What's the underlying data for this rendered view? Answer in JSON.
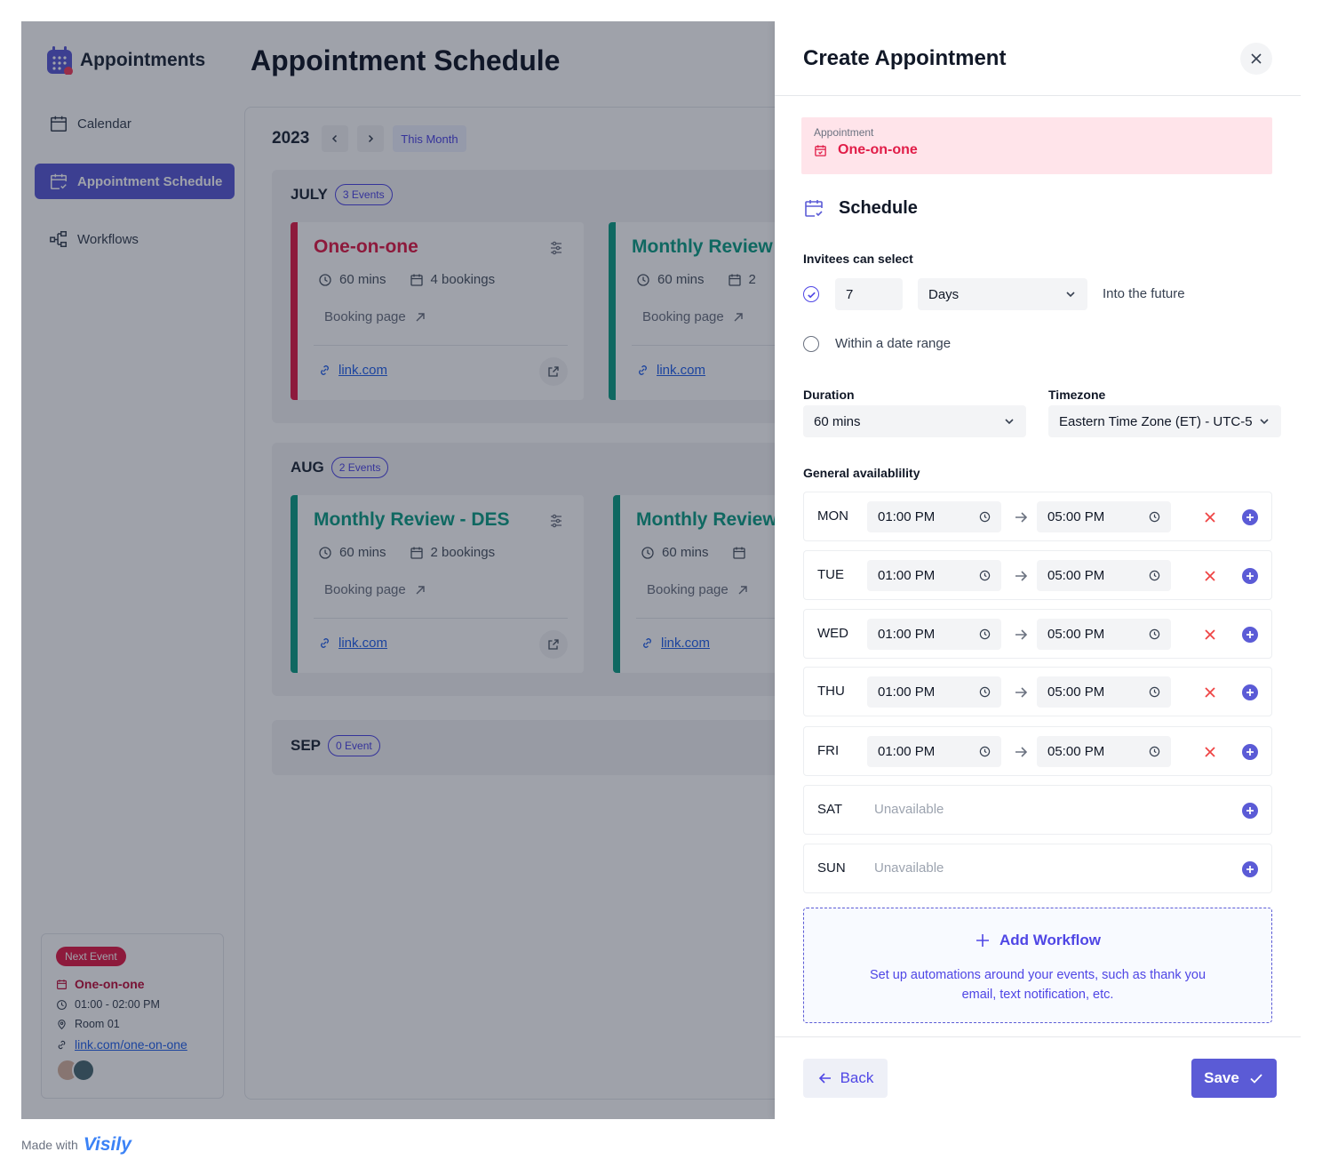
{
  "sidebar": {
    "brand": "Appointments",
    "items": [
      {
        "label": "Calendar",
        "icon": "calendar-icon"
      },
      {
        "label": "Appointment Schedule",
        "icon": "calendar-check-icon",
        "active": true
      },
      {
        "label": "Workflows",
        "icon": "workflow-icon"
      }
    ],
    "next_event": {
      "badge": "Next Event",
      "title": "One-on-one",
      "time": "01:00 - 02:00 PM",
      "location": "Room 01",
      "link": "link.com/one-on-one"
    }
  },
  "main": {
    "title": "Appointment Schedule",
    "year": "2023",
    "this_month": "This Month",
    "months": [
      {
        "name": "JULY",
        "events": "3 Events",
        "cards": [
          {
            "title": "One-on-one",
            "duration": "60 mins",
            "bookings": "4 bookings",
            "booking_page": "Booking page",
            "link": "link.com",
            "color": "#e11d48"
          },
          {
            "title": "Monthly Review",
            "duration": "60 mins",
            "bookings": "2",
            "booking_page": "Booking page",
            "link": "link.com",
            "color": "#0f9e86"
          }
        ]
      },
      {
        "name": "AUG",
        "events": "2 Events",
        "cards": [
          {
            "title": "Monthly Review - DES",
            "duration": "60 mins",
            "bookings": "2 bookings",
            "booking_page": "Booking page",
            "link": "link.com",
            "color": "#0f9e86"
          },
          {
            "title": "Monthly Review",
            "duration": "60 mins",
            "bookings": "",
            "booking_page": "Booking page",
            "link": "link.com",
            "color": "#0f9e86"
          }
        ]
      },
      {
        "name": "SEP",
        "events": "0 Event",
        "cards": []
      }
    ]
  },
  "drawer": {
    "title": "Create Appointment",
    "appointment_label": "Appointment",
    "appointment_value": "One-on-one",
    "schedule_heading": "Schedule",
    "invitees_label": "Invitees can select",
    "days_value": "7",
    "days_unit": "Days",
    "into_future": "Into the future",
    "within_range": "Within a date range",
    "duration_label": "Duration",
    "duration_value": "60 mins",
    "timezone_label": "Timezone",
    "timezone_value": "Eastern Time Zone (ET) - UTC-5",
    "availability_label": "General availablility",
    "days": [
      {
        "day": "MON",
        "from": "01:00 PM",
        "to": "05:00 PM"
      },
      {
        "day": "TUE",
        "from": "01:00 PM",
        "to": "05:00 PM"
      },
      {
        "day": "WED",
        "from": "01:00 PM",
        "to": "05:00 PM"
      },
      {
        "day": "THU",
        "from": "01:00 PM",
        "to": "05:00 PM"
      },
      {
        "day": "FRI",
        "from": "01:00 PM",
        "to": "05:00 PM"
      },
      {
        "day": "SAT",
        "status": "Unavailable"
      },
      {
        "day": "SUN",
        "status": "Unavailable"
      }
    ],
    "workflow": {
      "title": "Add Workflow",
      "description": "Set up automations around your events, such as thank you email, text notification, etc."
    },
    "back": "Back",
    "save": "Save"
  },
  "footer": {
    "made_with": "Made with",
    "brand": "Visily"
  },
  "colors": {
    "accent": "#5b5bd6",
    "pink": "#e11d48",
    "teal": "#0f9e86"
  }
}
